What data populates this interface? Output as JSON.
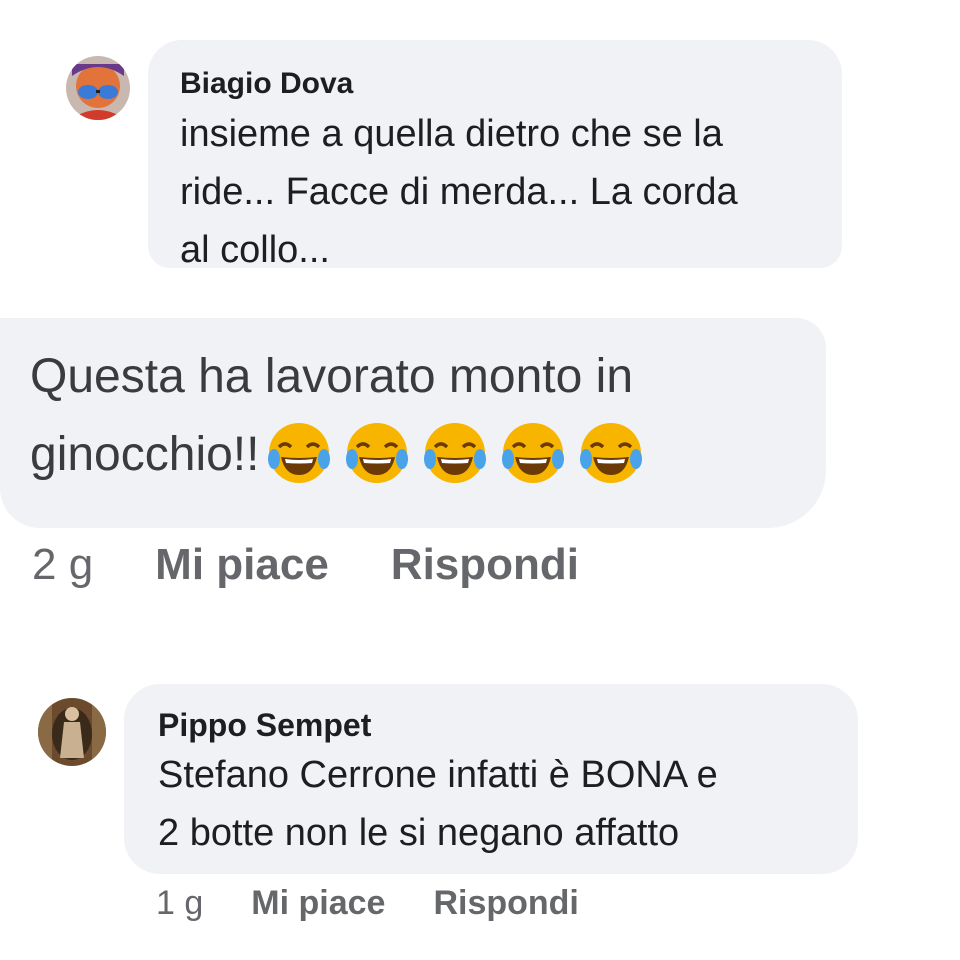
{
  "comments": [
    {
      "author": "Biagio Dova",
      "lines": [
        "insieme a quella dietro che se la",
        "ride... Facce di merda... La corda",
        "al collo..."
      ]
    },
    {
      "lines": [
        "Questa ha lavorato monto in",
        "ginocchio!!"
      ],
      "emoji": [
        "face-with-tears-of-joy-icon",
        "face-with-tears-of-joy-icon",
        "face-with-tears-of-joy-icon",
        "face-with-tears-of-joy-icon",
        "face-with-tears-of-joy-icon"
      ],
      "time": "2 g",
      "like_label": "Mi piace",
      "reply_label": "Rispondi"
    },
    {
      "author": "Pippo Sempet",
      "lines": [
        "Stefano Cerrone infatti è BONA e",
        "2 botte non le si negano affatto"
      ],
      "time": "1 g",
      "like_label": "Mi piace",
      "reply_label": "Rispondi"
    }
  ],
  "colors": {
    "bubble": "#f0f2f5",
    "text": "#1c1e21",
    "secondary_text": "#65676b",
    "emoji_face": "#f7b500"
  }
}
